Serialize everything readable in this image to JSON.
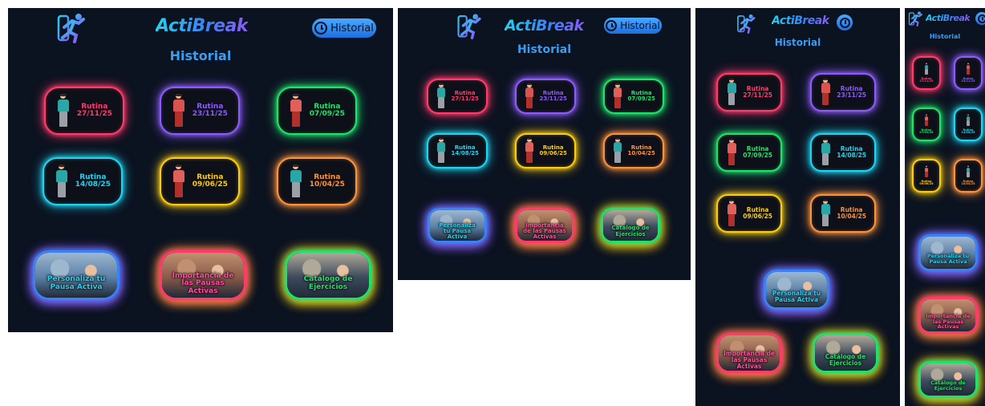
{
  "app": {
    "brand": "ActiBreak",
    "history_button_label": "Historial",
    "page_title": "Historial"
  },
  "routines": [
    {
      "title": "Rutina",
      "date": "27/11/25",
      "color": "#ff3b6b",
      "shirt": "#2aa6a6",
      "pants": "#9aa0a6"
    },
    {
      "title": "Rutina",
      "date": "23/11/25",
      "color": "#8b5cf6",
      "shirt": "#d9534f",
      "pants": "#b0302b"
    },
    {
      "title": "Rutina",
      "date": "07/09/25",
      "color": "#22e06b",
      "shirt": "#e0605c",
      "pants": "#b0302b"
    },
    {
      "title": "Rutina",
      "date": "14/08/25",
      "color": "#22d3ee",
      "shirt": "#2aa6a6",
      "pants": "#9aa0a6"
    },
    {
      "title": "Rutina",
      "date": "09/06/25",
      "color": "#facc15",
      "shirt": "#e0605c",
      "pants": "#b0302b"
    },
    {
      "title": "Rutina",
      "date": "10/04/25",
      "color": "#fb923c",
      "shirt": "#2aa6a6",
      "pants": "#9aa0a6"
    }
  ],
  "promos": [
    {
      "caption": "Personaliza tu Pausa Activa",
      "glow": "#3b82f6",
      "glow2": "#8b5cf6",
      "text_color": "#22d3ee",
      "scene": [
        "#5b7fa6",
        "#9db7cf"
      ]
    },
    {
      "caption": "Importancia de las Pausas Activas",
      "glow": "#ff3b6b",
      "glow2": "#fb923c",
      "text_color": "#ff4fa3",
      "scene": [
        "#8a5a4a",
        "#c09070"
      ]
    },
    {
      "caption": "Catálogo de Ejercicios",
      "glow": "#22e06b",
      "glow2": "#facc15",
      "text_color": "#22e06b",
      "scene": [
        "#3c4a5c",
        "#b0a898"
      ]
    }
  ],
  "views": [
    {
      "id": "p1",
      "name": "desktop"
    },
    {
      "id": "p2",
      "name": "laptop"
    },
    {
      "id": "p3",
      "name": "tablet"
    },
    {
      "id": "p4",
      "name": "mobile"
    }
  ]
}
